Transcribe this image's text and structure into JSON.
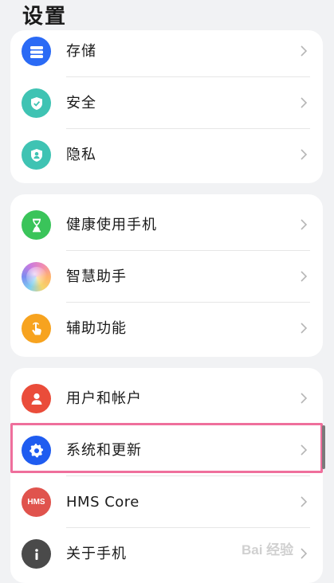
{
  "header": {
    "title": "设置"
  },
  "groups": [
    {
      "items": [
        {
          "label": "存储",
          "icon": "storage-icon",
          "color": "#2a6af5"
        },
        {
          "label": "安全",
          "icon": "shield-check-icon",
          "color": "#3fc3b3"
        },
        {
          "label": "隐私",
          "icon": "privacy-icon",
          "color": "#3fc3b3"
        }
      ]
    },
    {
      "items": [
        {
          "label": "健康使用手机",
          "icon": "hourglass-icon",
          "color": "#3ac45a"
        },
        {
          "label": "智慧助手",
          "icon": "assistant-icon",
          "color": "#c97be0"
        },
        {
          "label": "辅助功能",
          "icon": "hand-icon",
          "color": "#f7a31f"
        }
      ]
    },
    {
      "items": [
        {
          "label": "用户和帐户",
          "icon": "user-icon",
          "color": "#ea4c3a"
        },
        {
          "label": "系统和更新",
          "icon": "gear-icon",
          "color": "#1f5cf0"
        },
        {
          "label": "HMS Core",
          "icon": "hms-icon",
          "color": "#e0534d",
          "icon_text": "HMS"
        },
        {
          "label": "关于手机",
          "icon": "info-icon",
          "color": "#4a4a4a"
        }
      ]
    }
  ],
  "watermark": "Bai 经验"
}
